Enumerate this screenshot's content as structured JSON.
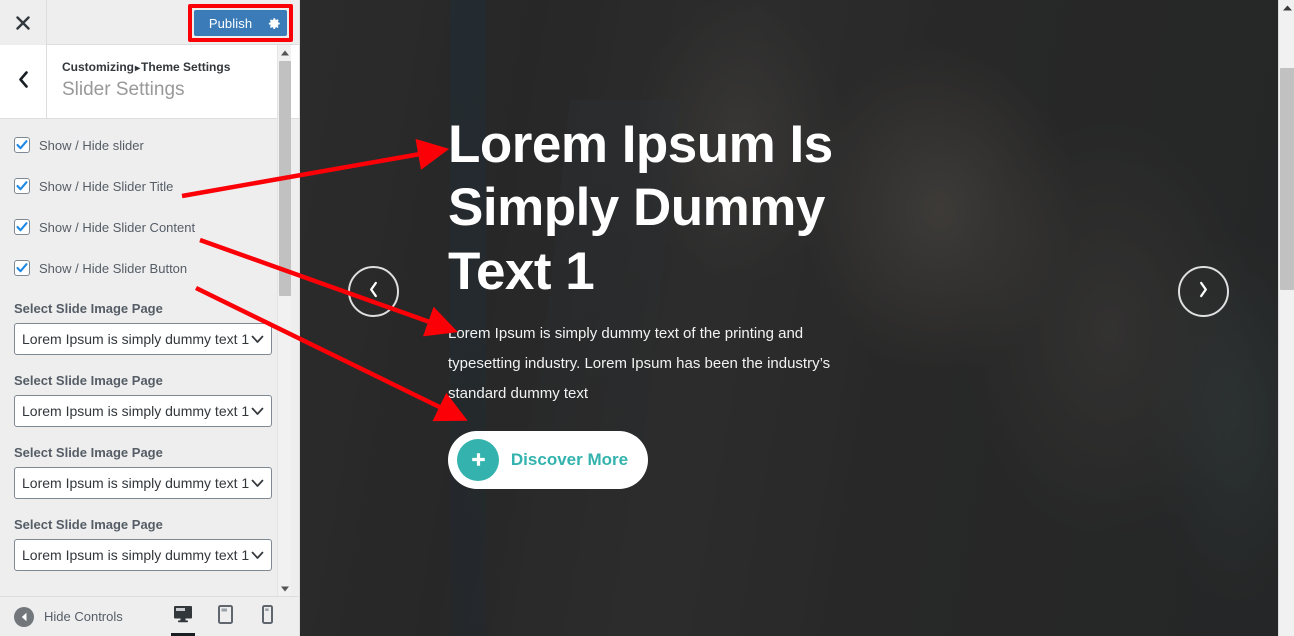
{
  "customizer": {
    "close_icon": "close-icon",
    "publish_label": "Publish",
    "publish_gear_icon": "gear-icon",
    "publish_accent": "#3b7cb8",
    "annotation_color": "#fb0007",
    "back_icon": "chevron-left-icon",
    "breadcrumb_root": "Customizing",
    "breadcrumb_separator": "▸",
    "breadcrumb_parent": "Theme Settings",
    "panel_title": "Slider Settings",
    "checkboxes": [
      {
        "label": "Show / Hide slider",
        "checked": true
      },
      {
        "label": "Show / Hide Slider Title",
        "checked": true
      },
      {
        "label": "Show / Hide Slider Content",
        "checked": true
      },
      {
        "label": "Show / Hide Slider Button",
        "checked": true
      }
    ],
    "selects": [
      {
        "label": "Select Slide Image Page",
        "value": "Lorem Ipsum is simply dummy text 1"
      },
      {
        "label": "Select Slide Image Page",
        "value": "Lorem Ipsum is simply dummy text 1"
      },
      {
        "label": "Select Slide Image Page",
        "value": "Lorem Ipsum is simply dummy text 1"
      },
      {
        "label": "Select Slide Image Page",
        "value": "Lorem Ipsum is simply dummy text 1"
      }
    ],
    "footer": {
      "hide_controls_label": "Hide Controls",
      "hide_controls_icon": "collapse-left-icon",
      "devices": [
        {
          "name": "desktop",
          "icon": "desktop-icon",
          "active": true
        },
        {
          "name": "tablet",
          "icon": "tablet-icon",
          "active": false
        },
        {
          "name": "mobile",
          "icon": "mobile-icon",
          "active": false
        }
      ]
    }
  },
  "preview": {
    "hero_title": "Lorem Ipsum Is Simply Dummy Text 1",
    "hero_description": "Lorem Ipsum is simply dummy text of the printing and typesetting industry. Lorem Ipsum has been the industry’s standard dummy text",
    "button_label": "Discover More",
    "button_icon": "plus-icon",
    "button_accent": "#34b3ae",
    "prev_icon": "chevron-left-icon",
    "next_icon": "chevron-right-icon"
  }
}
